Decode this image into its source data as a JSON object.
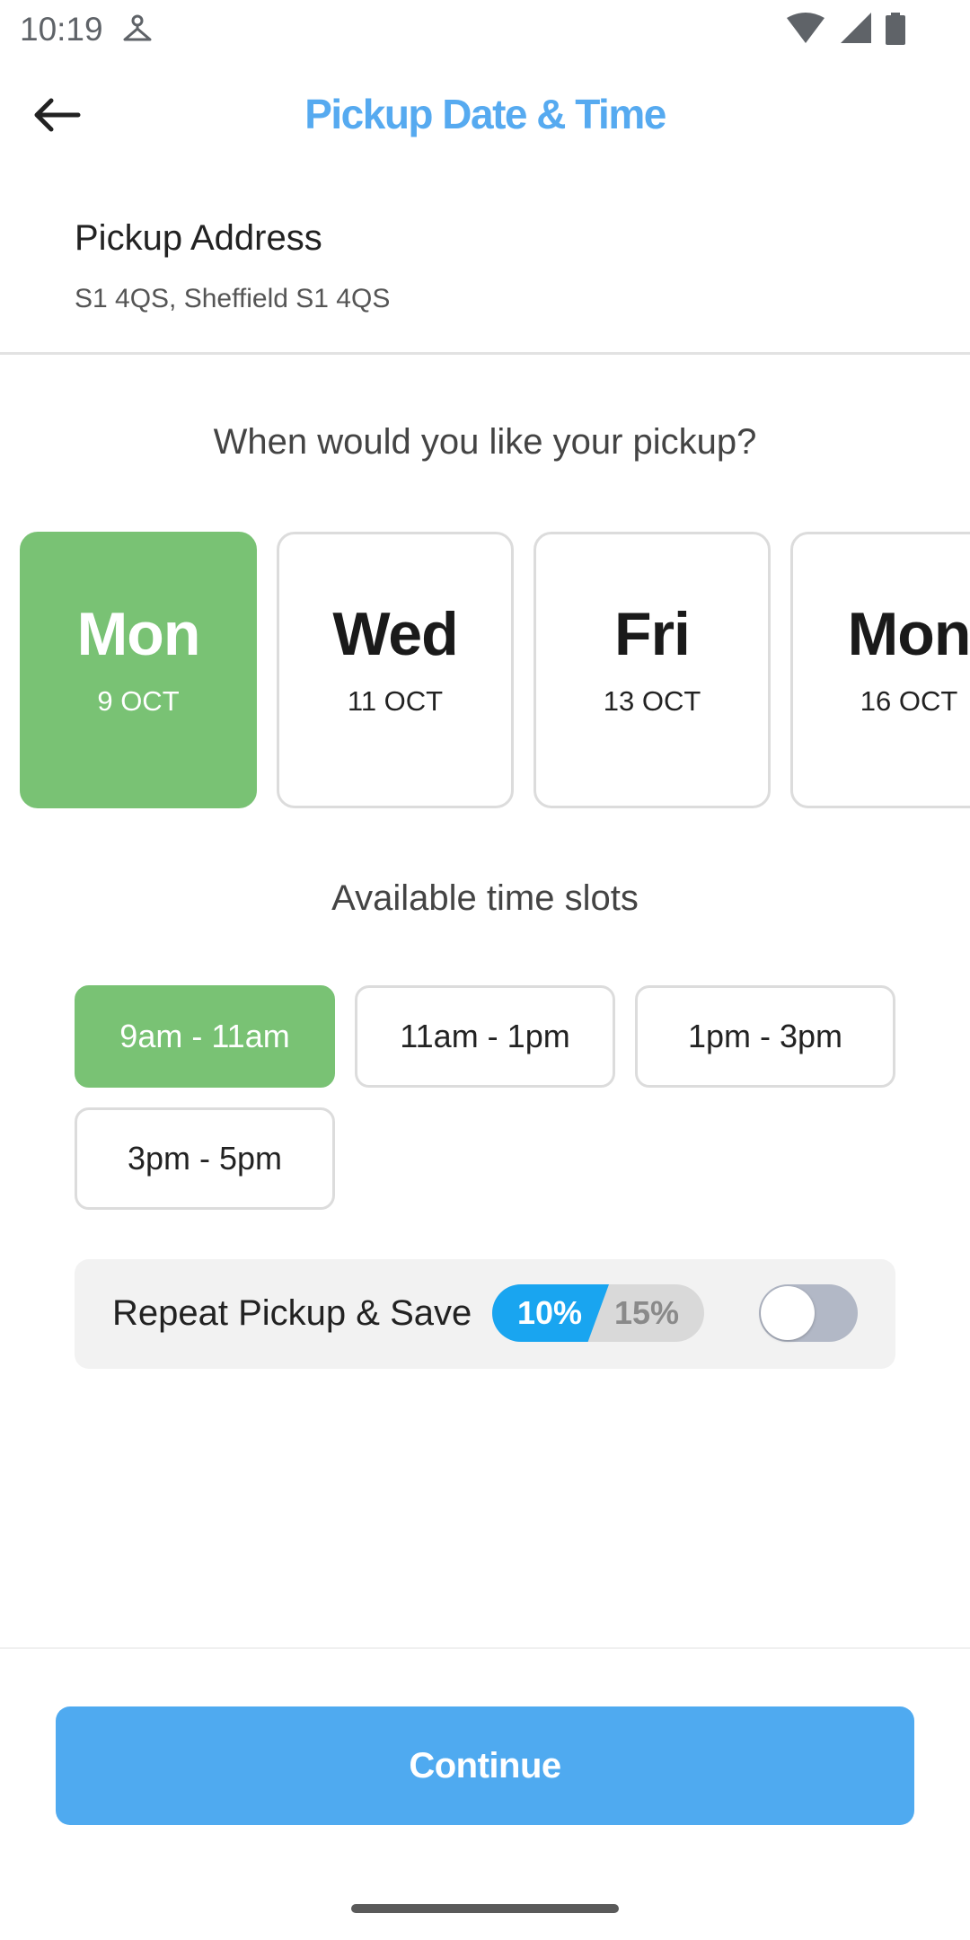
{
  "status_bar": {
    "time": "10:19",
    "icons": [
      "person-icon",
      "wifi-icon",
      "signal-icon",
      "battery-icon"
    ]
  },
  "header": {
    "back_icon": "arrow-left-icon",
    "title": "Pickup Date & Time"
  },
  "address": {
    "title": "Pickup Address",
    "value": "S1 4QS, Sheffield S1 4QS"
  },
  "prompt": "When would you like your pickup?",
  "dates": [
    {
      "day": "Mon",
      "date": "9 OCT",
      "selected": true
    },
    {
      "day": "Wed",
      "date": "11 OCT",
      "selected": false
    },
    {
      "day": "Fri",
      "date": "13 OCT",
      "selected": false
    },
    {
      "day": "Mon",
      "date": "16 OCT",
      "selected": false
    }
  ],
  "slots_title": "Available time slots",
  "slots": [
    {
      "label": "9am - 11am",
      "selected": true
    },
    {
      "label": "11am - 1pm",
      "selected": false
    },
    {
      "label": "1pm - 3pm",
      "selected": false
    },
    {
      "label": "3pm - 5pm",
      "selected": false
    }
  ],
  "repeat": {
    "label": "Repeat Pickup & Save",
    "discount_a": "10%",
    "discount_b": "15%",
    "enabled": false
  },
  "continue_label": "Continue",
  "colors": {
    "accent_blue": "#4faaf0",
    "title_blue": "#56aaf0",
    "selected_green": "#79c274",
    "discount_blue": "#19a5f0"
  }
}
